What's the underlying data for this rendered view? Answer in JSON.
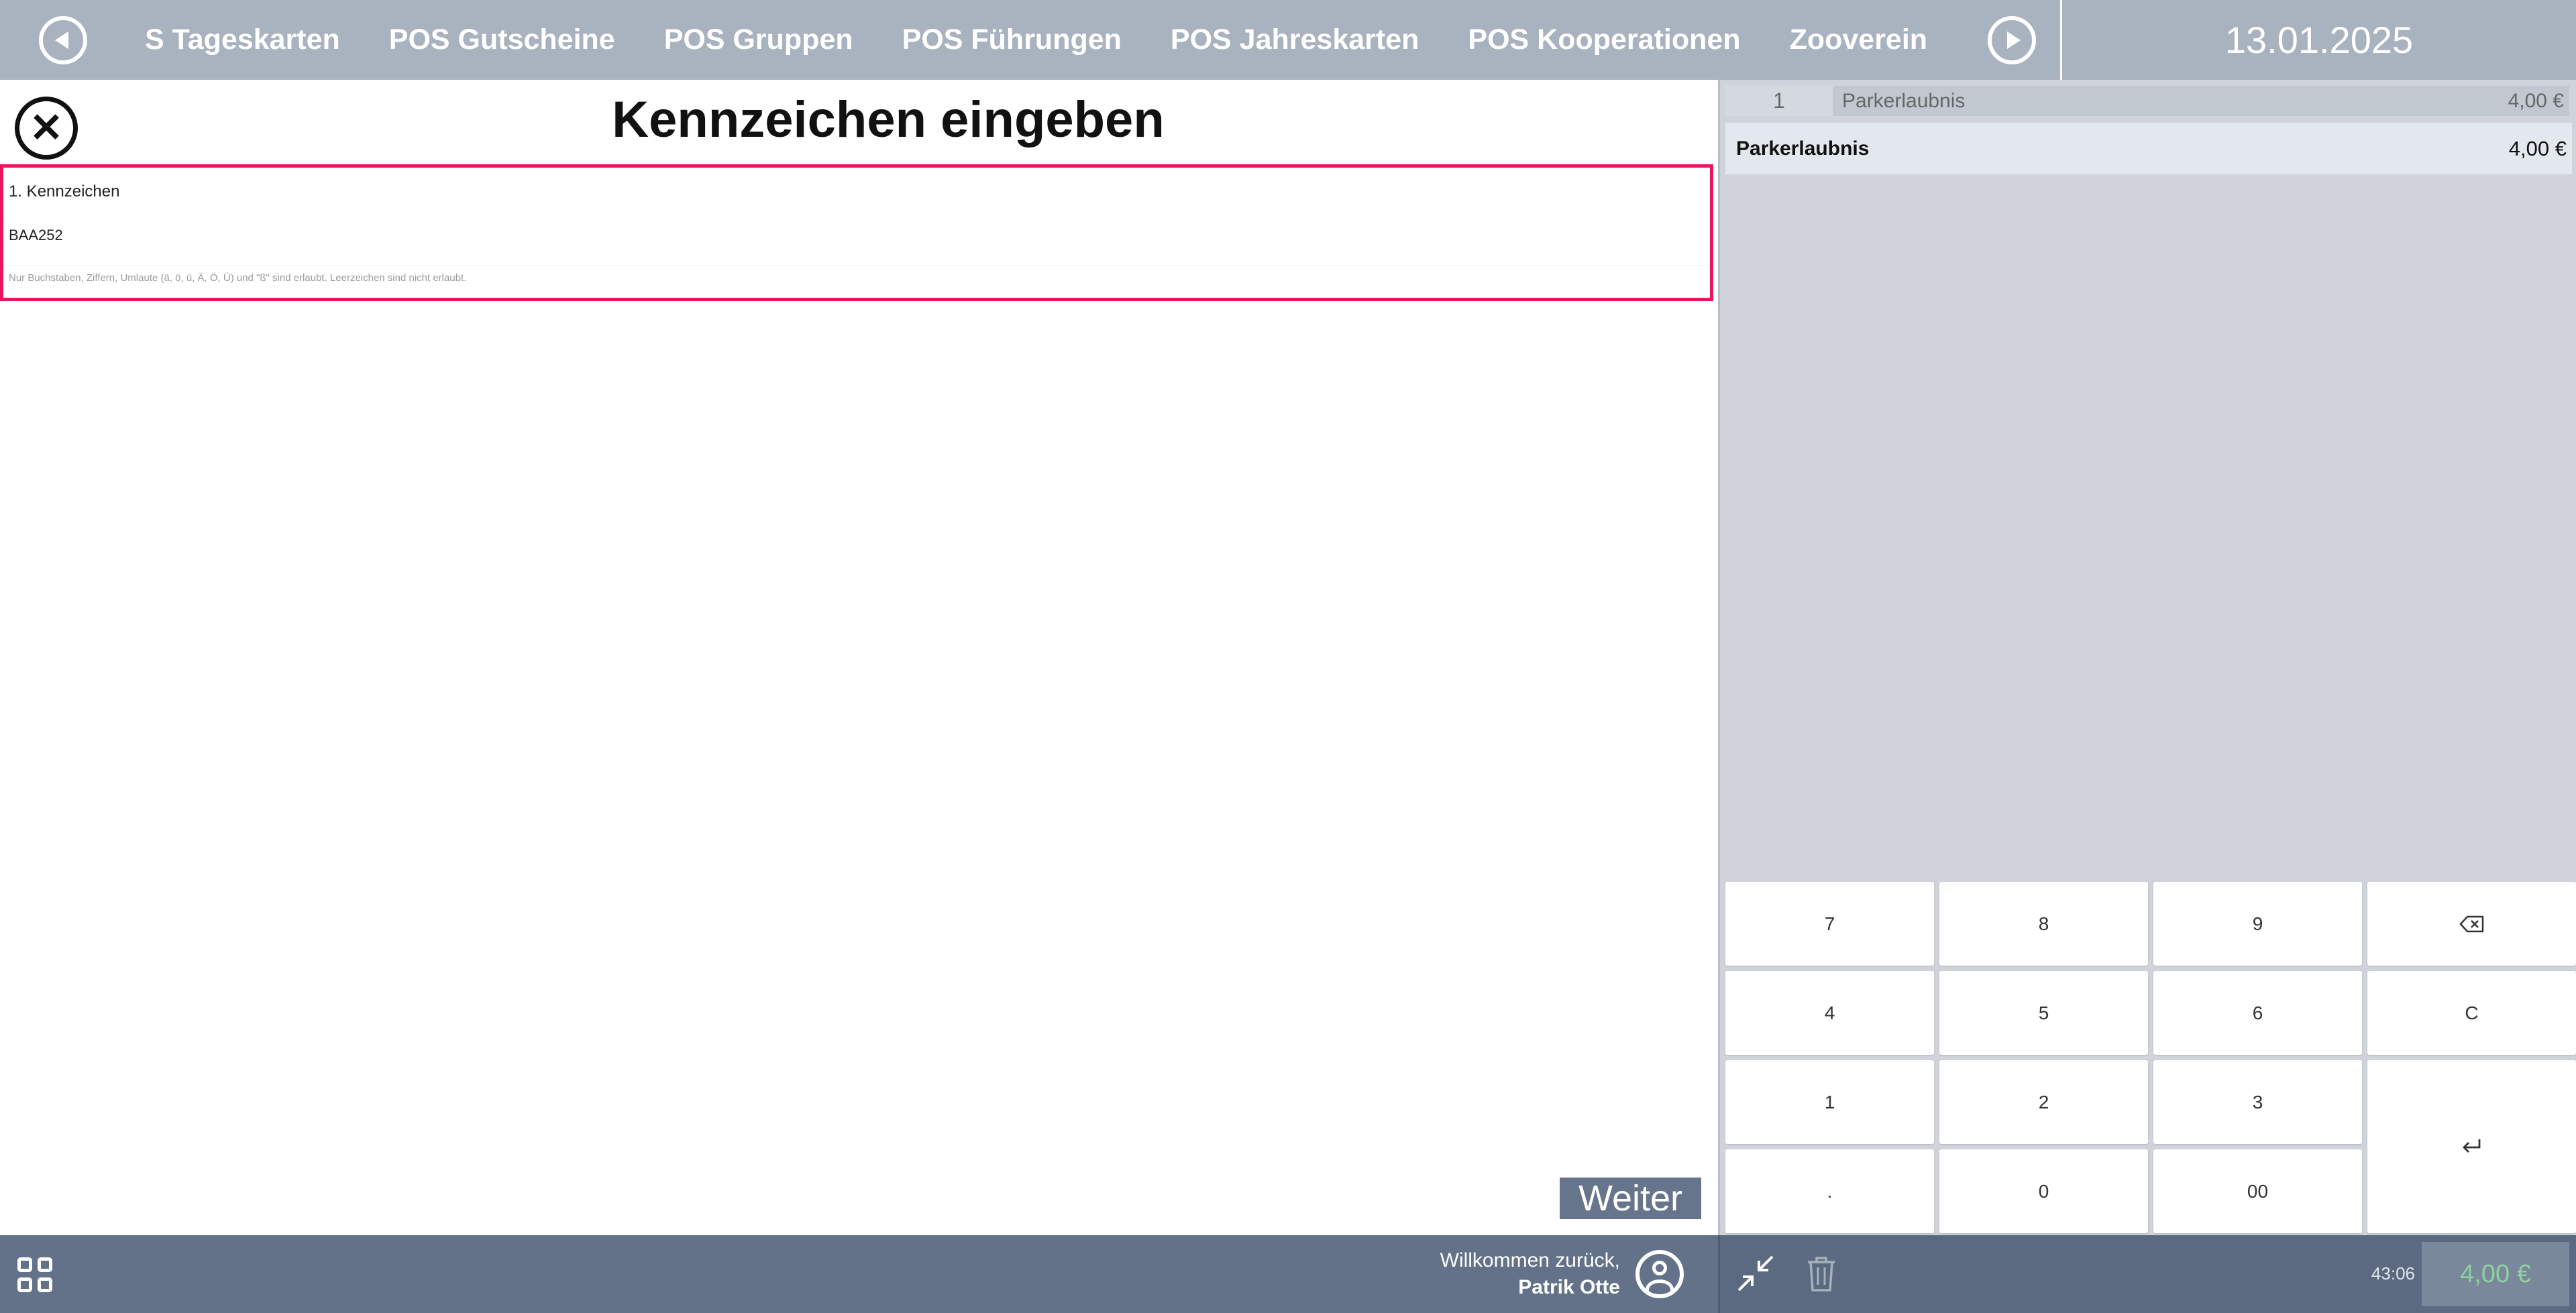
{
  "topbar": {
    "tabs": [
      "S Tageskarten",
      "POS Gutscheine",
      "POS Gruppen",
      "POS Führungen",
      "POS Jahreskarten",
      "POS Kooperationen",
      "Zooverein"
    ],
    "date": "13.01.2025"
  },
  "dialog": {
    "title": "Kennzeichen eingeben",
    "field_label": "1. Kennzeichen",
    "field_value": "BAA252",
    "field_hint": "Nur Buchstaben, Ziffern, Umlaute (ä, ö, ü, Ä, Ö, Ü) und \"ß\" sind erlaubt. Leerzeichen sind nicht erlaubt.",
    "next_label": "Weiter"
  },
  "cart": {
    "item_qty": "1",
    "item_name": "Parkerlaubnis",
    "item_price": "4,00 €",
    "selected_name": "Parkerlaubnis",
    "selected_price": "4,00 €"
  },
  "numpad": {
    "keys": [
      "7",
      "8",
      "9",
      "4",
      "5",
      "6",
      "C",
      "1",
      "2",
      "3",
      ".",
      "0",
      "00"
    ]
  },
  "footer": {
    "welcome_line": "Willkommen zurück,",
    "user_name": "Patrik Otte",
    "timer": "43:06",
    "total": "4,00 €"
  },
  "colors": {
    "topbar": "#a9b2bf",
    "footer": "#637289",
    "highlight_border": "#e8175d",
    "total_text": "#8fd19e"
  },
  "icons": [
    "prev-icon",
    "next-icon",
    "close-icon",
    "backspace-icon",
    "enter-icon",
    "apps-grid-icon",
    "user-icon",
    "collapse-icon",
    "trash-icon"
  ]
}
